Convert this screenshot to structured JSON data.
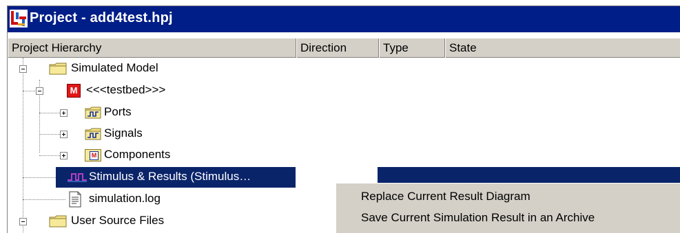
{
  "window": {
    "title": "Project - add4test.hpj"
  },
  "columns": [
    "Project Hierarchy",
    "Direction",
    "Type",
    "State"
  ],
  "tree": {
    "simulated_model": "Simulated Model",
    "testbed": "<<<testbed>>>",
    "testbed_badge": "M",
    "ports": "Ports",
    "signals": "Signals",
    "components": "Components",
    "components_badge": "M",
    "stimulus": "Stimulus & Results (Stimulus…",
    "simulation_log": "simulation.log",
    "user_source_files": "User Source Files"
  },
  "context_menu": {
    "items": [
      "Replace Current Result Diagram",
      "Save Current Simulation Result in an Archive"
    ]
  },
  "colors": {
    "titlebar": "#001e87",
    "selection": "#0a246a",
    "menu_bg": "#d4d0c8"
  }
}
